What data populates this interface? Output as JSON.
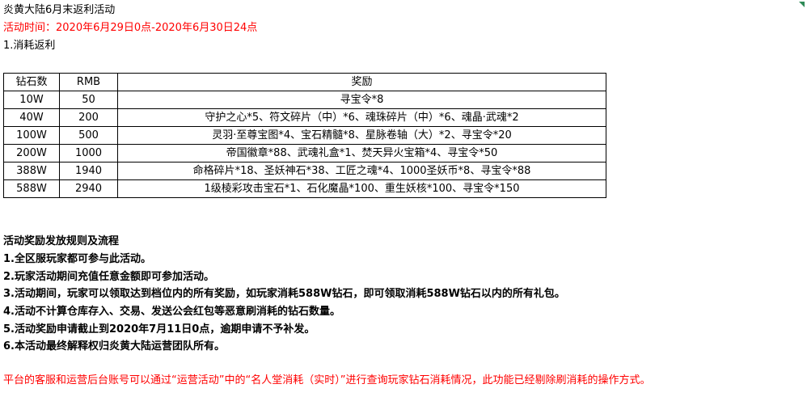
{
  "title": "炎黄大陆6月末返利活动",
  "time": "活动时间：2020年6月29日0点-2020年6月30日24点",
  "section": "1.消耗返利",
  "table": {
    "headers": [
      "钻石数",
      "RMB",
      "奖励"
    ],
    "rows": [
      [
        "10W",
        "50",
        "寻宝令*8"
      ],
      [
        "40W",
        "200",
        "守护之心*5、符文碎片（中）*6、魂珠碎片（中）*6、魂晶·武魂*2"
      ],
      [
        "100W",
        "500",
        "灵羽·至尊宝图*4、宝石精髓*8、星脉卷轴（大）*2、寻宝令*20"
      ],
      [
        "200W",
        "1000",
        "帝国徽章*88、武魂礼盒*1、焚天异火宝箱*4、寻宝令*50"
      ],
      [
        "388W",
        "1940",
        "命格碎片*18、圣妖神石*38、工匠之魂*4、1000圣妖币*8、寻宝令*88"
      ],
      [
        "588W",
        "2940",
        "1级棱彩攻击宝石*1、石化魔晶*100、重生妖核*100、寻宝令*150"
      ]
    ]
  },
  "rules": {
    "title": "活动奖励发放规则及流程",
    "items": [
      "1.全区服玩家都可参与此活动。",
      "2.玩家活动期间充值任意金额即可参加活动。",
      "3.活动期间，玩家可以领取达到档位内的所有奖励，如玩家消耗588W钻石，即可领取消耗588W钻石以内的所有礼包。",
      "4.活动不计算仓库存入、交易、发送公会红包等恶意刷消耗的钻石数量。",
      "5.活动奖励申请截止到2020年7月11日0点，逾期申请不予补发。",
      "6.本活动最终解释权归炎黄大陆运营团队所有。"
    ]
  },
  "footer": "平台的客服和运营后台账号可以通过“运营活动”中的“名人堂消耗（实时）”进行查询玩家钻石消耗情况，此功能已经剔除刷消耗的操作方式。",
  "colors": {
    "highlight": "#ff0000",
    "corner_mark": "#2e8b57"
  }
}
